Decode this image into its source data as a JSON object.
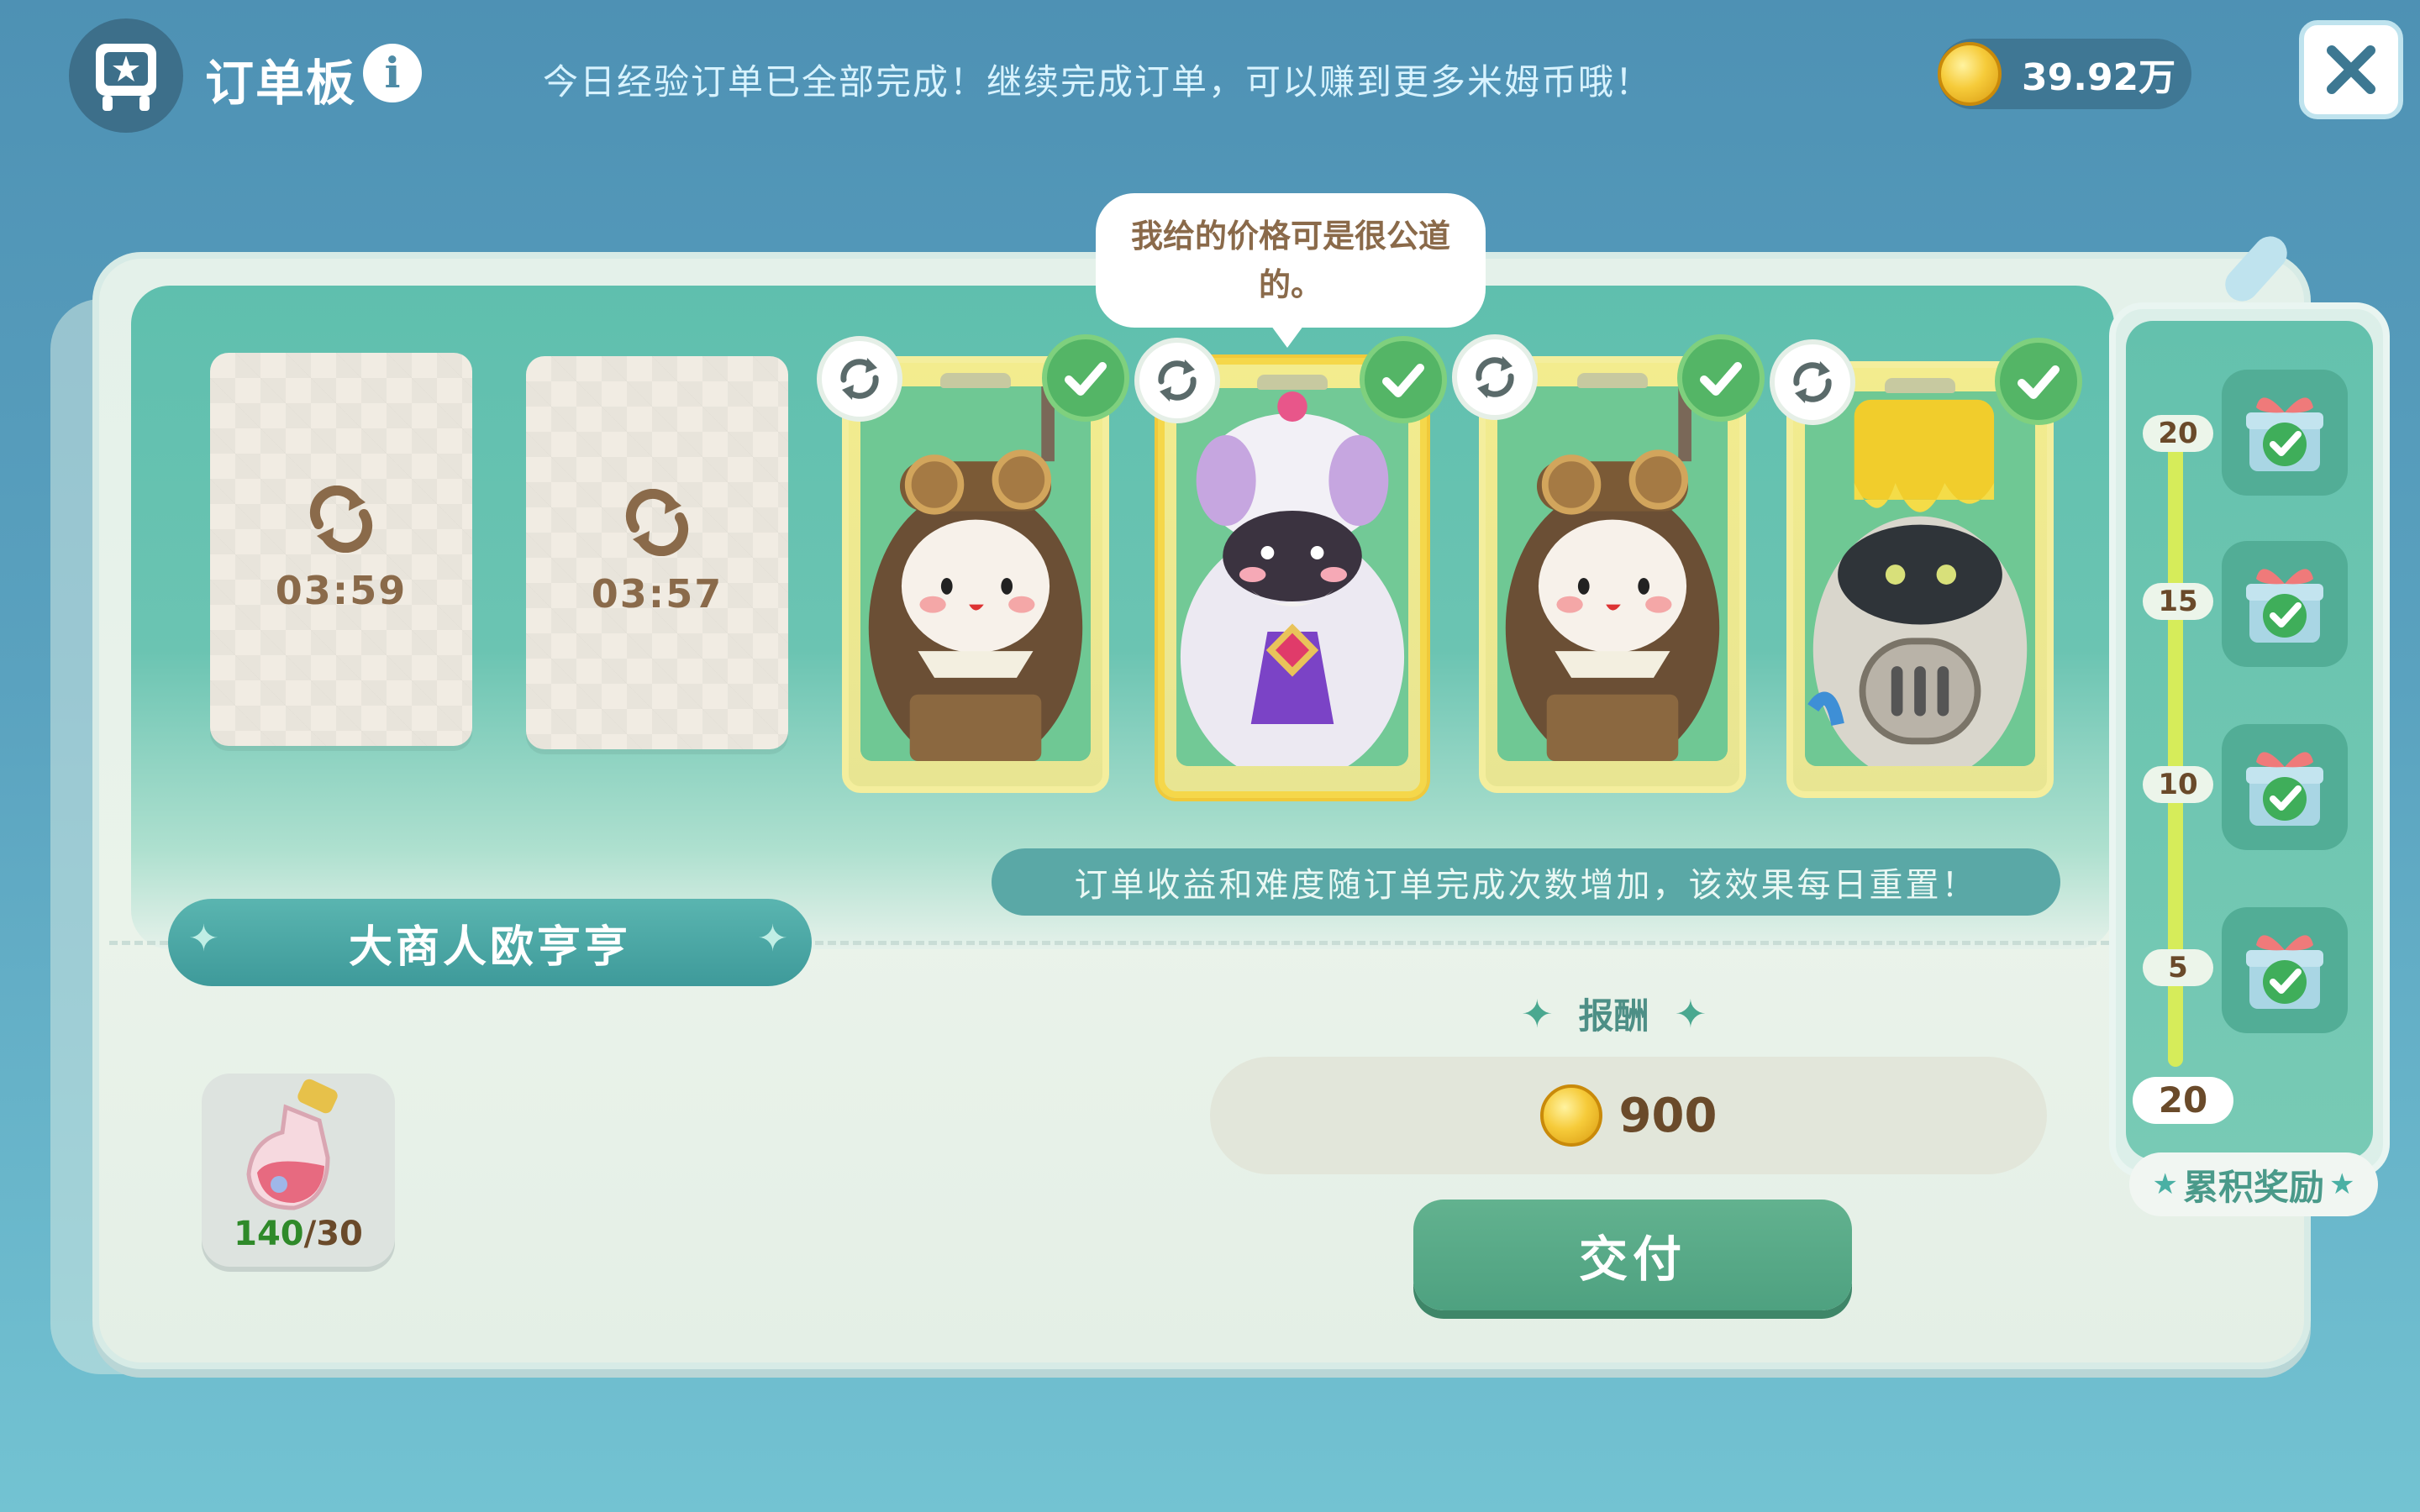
{
  "header": {
    "title": "订单板",
    "info_label": "i",
    "message": "今日经验订单已全部完成！继续完成订单，可以赚到更多米姆币哦！",
    "currency_amount": "39.92万",
    "close_label": "✕"
  },
  "orders": {
    "empty_slots": [
      {
        "timer": "03:59"
      },
      {
        "timer": "03:57"
      }
    ],
    "character_slots": [
      {
        "character": "aviator-goggles",
        "completed": true,
        "selected": false
      },
      {
        "character": "merchant-oheng",
        "completed": true,
        "selected": true
      },
      {
        "character": "aviator-goggles",
        "completed": true,
        "selected": false
      },
      {
        "character": "paint-bucket-robot",
        "completed": true,
        "selected": false
      }
    ],
    "speech_bubble": "我给的价格可是很公道的。",
    "info_banner": "订单收益和难度随订单完成次数增加，该效果每日重置！"
  },
  "merchant": {
    "name": "大商人欧亨亨"
  },
  "requirement": {
    "item_icon": "potion-bottle-icon",
    "have": "140",
    "need": "/30"
  },
  "reward": {
    "label": "报酬",
    "amount": "900"
  },
  "actions": {
    "deliver_label": "交付"
  },
  "tracker": {
    "milestones": [
      {
        "value": "20",
        "claimed": true
      },
      {
        "value": "15",
        "claimed": true
      },
      {
        "value": "10",
        "claimed": true
      },
      {
        "value": "5",
        "claimed": true
      }
    ],
    "progress": "20",
    "label": "累积奖励"
  },
  "colors": {
    "background": "#5aa2bf",
    "panel": "#e4f1ea",
    "panel_inner": "#64c1ad",
    "accent_green": "#54b566",
    "card_frame": "#f3ec8e",
    "button": "#4ea180"
  }
}
